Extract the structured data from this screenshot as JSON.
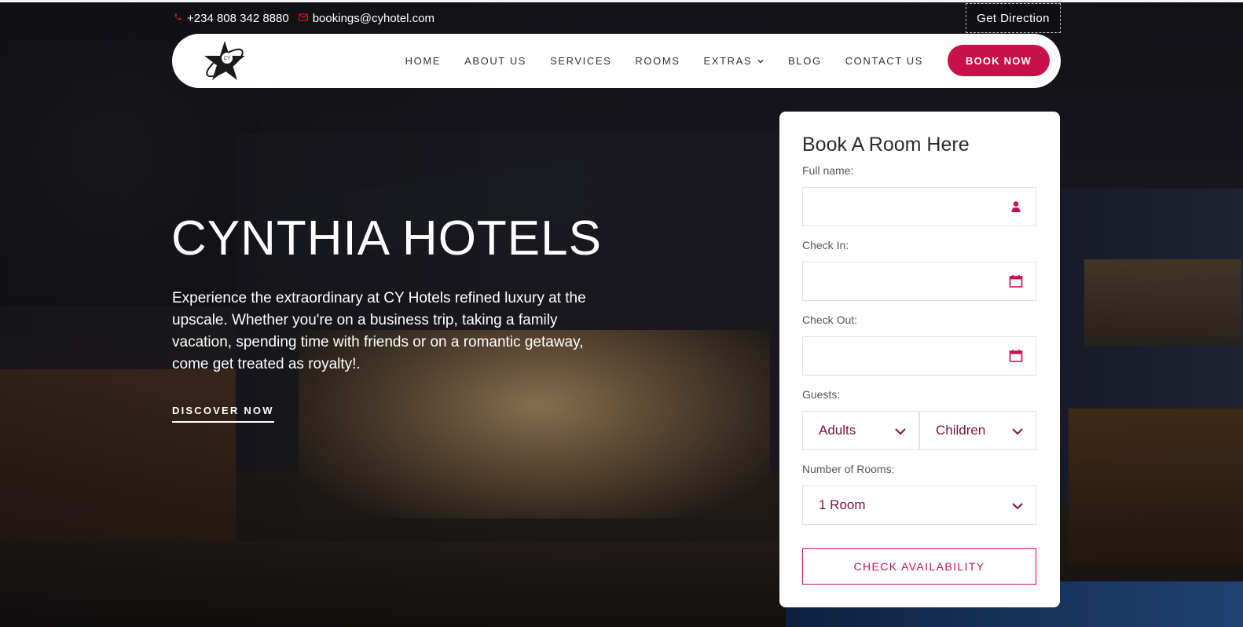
{
  "topbar": {
    "phone": "+234 808 342 8880",
    "email": "bookings@cyhotel.com",
    "get_direction": "Get Direction"
  },
  "nav": {
    "items": [
      {
        "label": "HOME"
      },
      {
        "label": "ABOUT US"
      },
      {
        "label": "SERVICES"
      },
      {
        "label": "ROOMS"
      },
      {
        "label": "EXTRAS"
      },
      {
        "label": "BLOG"
      },
      {
        "label": "CONTACT US"
      }
    ],
    "book_now": "BOOK NOW"
  },
  "hero": {
    "title": "CYNTHIA HOTELS",
    "description": "Experience the extraordinary at CY Hotels refined luxury at the upscale. Whether you're on a business trip, taking a family vacation, spending time with friends or on a romantic getaway, come get treated as royalty!.",
    "cta": "DISCOVER NOW"
  },
  "booking": {
    "title": "Book A Room Here",
    "full_name_label": "Full name:",
    "check_in_label": "Check In:",
    "check_out_label": "Check Out:",
    "guests_label": "Guests:",
    "adults": "Adults",
    "children": "Children",
    "rooms_label": "Number of Rooms:",
    "rooms_value": "1 Room",
    "submit": "CHECK AVAILABILITY"
  },
  "colors": {
    "accent": "#c8104b",
    "select_text": "#7a1340"
  }
}
